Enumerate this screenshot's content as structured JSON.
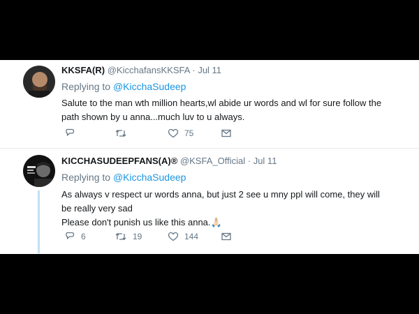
{
  "tweets": [
    {
      "display_name": "KKSFA(R)",
      "handle": "@KicchafansKKSFA",
      "sep": "·",
      "date": "Jul 11",
      "replying_prefix": "Replying to",
      "replying_to": "@KicchaSudeep",
      "body_lines": [
        "Salute to the man wth million hearts,wl abide ur words and wl for sure follow the",
        "path shown by u anna...much luv to u always."
      ],
      "replies": "",
      "retweets": "",
      "likes": "75"
    },
    {
      "display_name": "KICCHASUDEEPFANS(A)®",
      "handle": "@KSFA_Official",
      "sep": "·",
      "date": "Jul 11",
      "replying_prefix": "Replying to",
      "replying_to": "@KicchaSudeep",
      "body_lines": [
        "As always v respect ur words anna, but just 2 see u mny ppl will come, they will",
        "be really very sad",
        "Please don't punish us like this anna.🙏🏻"
      ],
      "replies": "6",
      "retweets": "19",
      "likes": "144"
    }
  ],
  "colors": {
    "accent": "#1b95e0",
    "muted": "#657786",
    "text": "#14171a",
    "thread": "#c4dff2"
  },
  "icons": [
    "reply-icon",
    "retweet-icon",
    "like-icon",
    "message-icon"
  ]
}
